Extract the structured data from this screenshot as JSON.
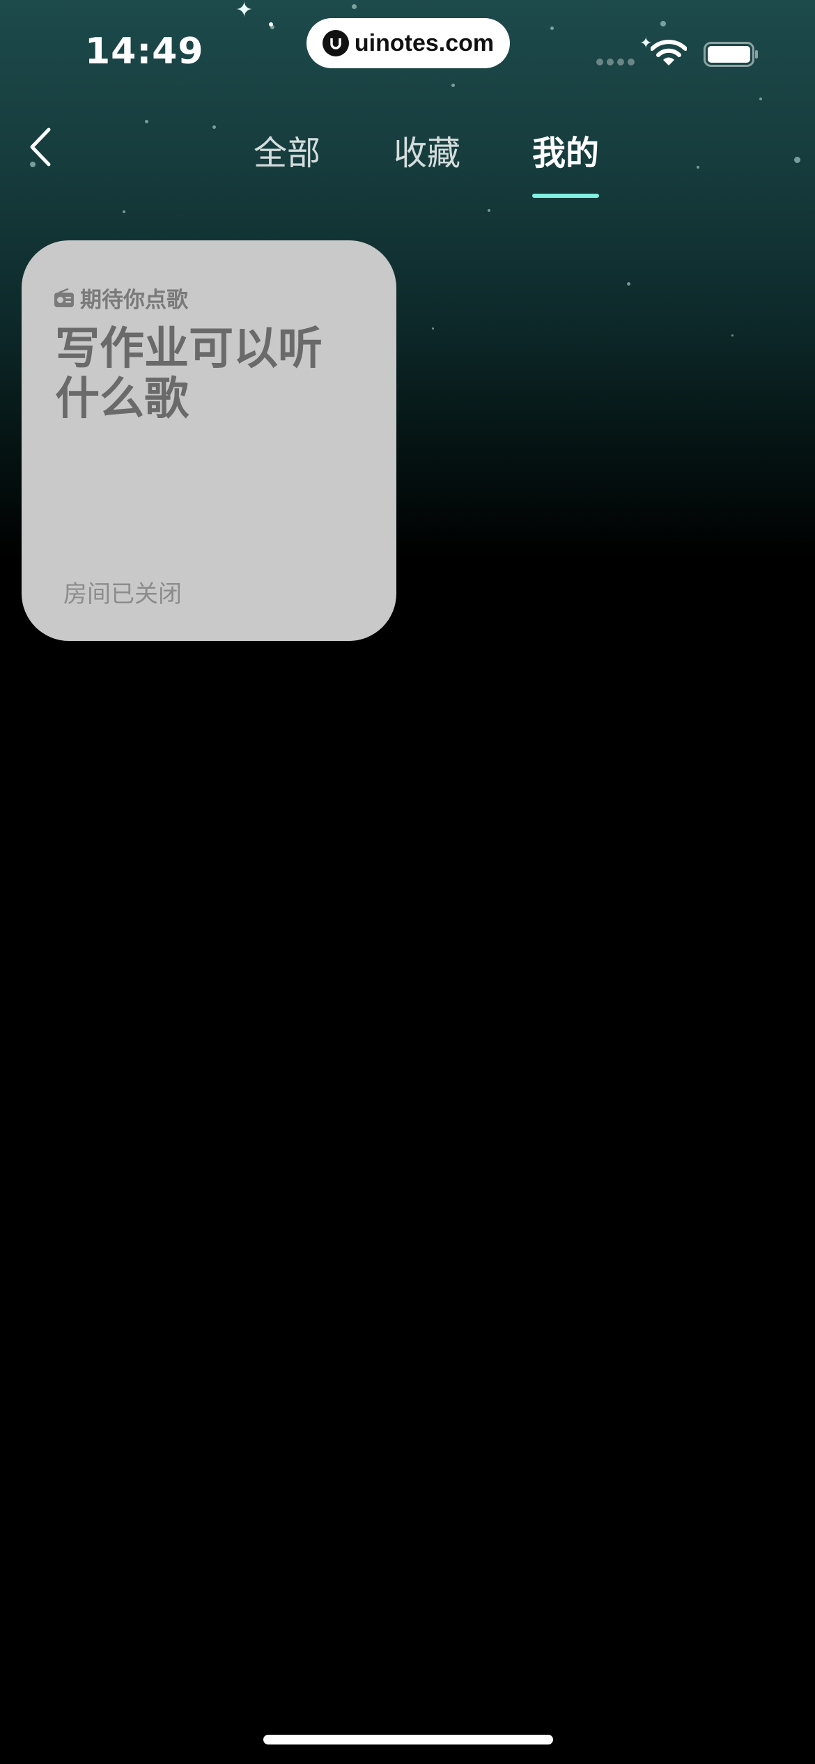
{
  "status_bar": {
    "time": "14:49",
    "watermark": "uinotes.com",
    "battery_level": 1.0
  },
  "nav": {
    "back_icon": "chevron-left-icon",
    "tabs": [
      {
        "label": "全部",
        "active": false
      },
      {
        "label": "收藏",
        "active": false
      },
      {
        "label": "我的",
        "active": true
      }
    ],
    "indicator_color": "#7ff0e2"
  },
  "room_card": {
    "tag_icon": "radio-icon",
    "tag": "期待你点歌",
    "title": "写作业可以听什么歌",
    "status": "房间已关闭",
    "background": "#c9c9c9"
  },
  "colors": {
    "background_top": "#1d4a4b",
    "background_bottom": "#000000"
  }
}
